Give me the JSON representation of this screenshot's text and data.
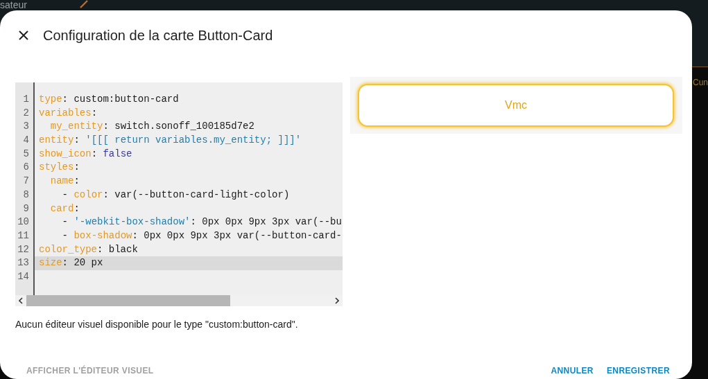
{
  "background": {
    "top_text": "sateur",
    "side_text": "Cun"
  },
  "dialog": {
    "title": "Configuration de la carte Button-Card"
  },
  "editor": {
    "lines": [
      {
        "number": "1",
        "selected": false,
        "tokens": [
          {
            "kind": "key",
            "text": "type"
          },
          {
            "kind": "plain",
            "text": ": custom:button-card"
          }
        ]
      },
      {
        "number": "2",
        "selected": false,
        "tokens": [
          {
            "kind": "key",
            "text": "variables"
          },
          {
            "kind": "plain",
            "text": ":"
          }
        ]
      },
      {
        "number": "3",
        "selected": false,
        "tokens": [
          {
            "kind": "key",
            "text": "  my_entity"
          },
          {
            "kind": "plain",
            "text": ": switch.sonoff_100185d7e2"
          }
        ]
      },
      {
        "number": "4",
        "selected": false,
        "tokens": [
          {
            "kind": "key",
            "text": "entity"
          },
          {
            "kind": "plain",
            "text": ": "
          },
          {
            "kind": "string",
            "text": "'[[[ return variables.my_entity; ]]]'"
          }
        ]
      },
      {
        "number": "5",
        "selected": false,
        "tokens": [
          {
            "kind": "key",
            "text": "show_icon"
          },
          {
            "kind": "plain",
            "text": ": "
          },
          {
            "kind": "atom",
            "text": "false"
          }
        ]
      },
      {
        "number": "6",
        "selected": false,
        "tokens": [
          {
            "kind": "key",
            "text": "styles"
          },
          {
            "kind": "plain",
            "text": ":"
          }
        ]
      },
      {
        "number": "7",
        "selected": false,
        "tokens": [
          {
            "kind": "key",
            "text": "  name"
          },
          {
            "kind": "plain",
            "text": ":"
          }
        ]
      },
      {
        "number": "8",
        "selected": false,
        "tokens": [
          {
            "kind": "plain",
            "text": "    - "
          },
          {
            "kind": "key",
            "text": "color"
          },
          {
            "kind": "plain",
            "text": ": var(--button-card-light-color)"
          }
        ]
      },
      {
        "number": "9",
        "selected": false,
        "tokens": [
          {
            "kind": "key",
            "text": "  card"
          },
          {
            "kind": "plain",
            "text": ":"
          }
        ]
      },
      {
        "number": "10",
        "selected": false,
        "tokens": [
          {
            "kind": "plain",
            "text": "    - "
          },
          {
            "kind": "string",
            "text": "'-webkit-box-shadow'"
          },
          {
            "kind": "plain",
            "text": ": 0px 0px 9px 3px var(--bu"
          }
        ]
      },
      {
        "number": "11",
        "selected": false,
        "tokens": [
          {
            "kind": "plain",
            "text": "    - "
          },
          {
            "kind": "key",
            "text": "box-shadow"
          },
          {
            "kind": "plain",
            "text": ": 0px 0px 9px 3px var(--button-card-"
          }
        ]
      },
      {
        "number": "12",
        "selected": false,
        "tokens": [
          {
            "kind": "key",
            "text": "color_type"
          },
          {
            "kind": "plain",
            "text": ": black"
          }
        ]
      },
      {
        "number": "13",
        "selected": true,
        "tokens": [
          {
            "kind": "key",
            "text": "size"
          },
          {
            "kind": "plain",
            "text": ": 20 px"
          }
        ]
      },
      {
        "number": "14",
        "selected": false
      }
    ]
  },
  "preview": {
    "card_label": "Vmc"
  },
  "message": "Aucun éditeur visuel disponible pour le type \"custom:button-card\".",
  "footer": {
    "toggle_button": {
      "label": "AFFICHER L'ÉDITEUR VISUEL",
      "disabled": true
    },
    "actions": [
      {
        "label": "ANNULER",
        "disabled": false
      },
      {
        "label": "ENREGISTRER",
        "disabled": false
      }
    ]
  }
}
